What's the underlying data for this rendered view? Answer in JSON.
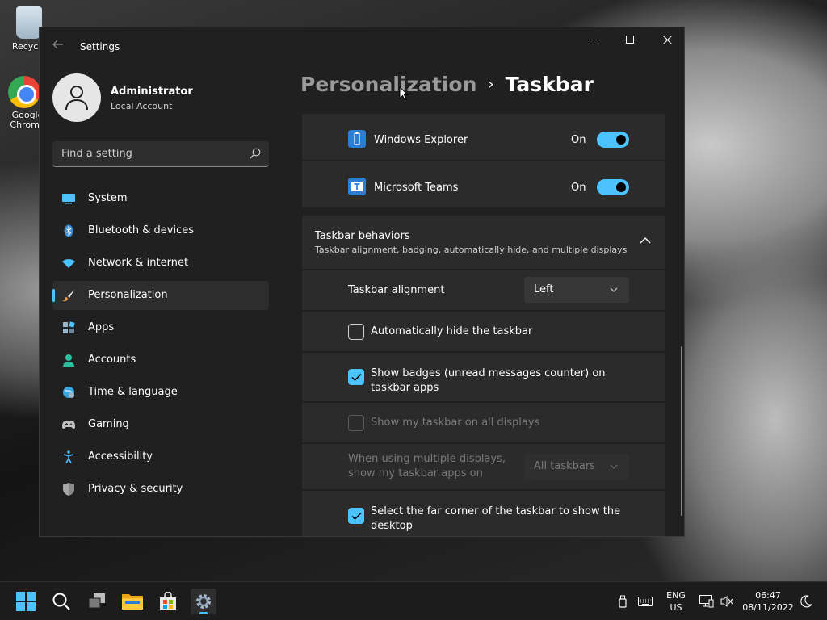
{
  "desktop": {
    "icons": [
      {
        "label": "Recycle"
      },
      {
        "label": "Google Chrome"
      }
    ]
  },
  "window": {
    "title": "Settings",
    "minimize_label": "minimize",
    "maximize_label": "maximize",
    "close_label": "close"
  },
  "profile": {
    "name": "Administrator",
    "account_type": "Local Account"
  },
  "search": {
    "placeholder": "Find a setting"
  },
  "sidebar": {
    "items": [
      {
        "label": "System",
        "icon": "monitor-icon"
      },
      {
        "label": "Bluetooth & devices",
        "icon": "bluetooth-icon"
      },
      {
        "label": "Network & internet",
        "icon": "wifi-icon"
      },
      {
        "label": "Personalization",
        "icon": "brush-icon",
        "active": true
      },
      {
        "label": "Apps",
        "icon": "apps-icon"
      },
      {
        "label": "Accounts",
        "icon": "person-icon"
      },
      {
        "label": "Time & language",
        "icon": "globe-icon"
      },
      {
        "label": "Gaming",
        "icon": "gamepad-icon"
      },
      {
        "label": "Accessibility",
        "icon": "accessibility-icon"
      },
      {
        "label": "Privacy & security",
        "icon": "shield-icon"
      }
    ]
  },
  "breadcrumb": {
    "parent": "Personalization",
    "separator": "›",
    "current": "Taskbar"
  },
  "apps": [
    {
      "label": "Windows Explorer",
      "state": "On"
    },
    {
      "label": "Microsoft Teams",
      "state": "On"
    }
  ],
  "behaviors": {
    "title": "Taskbar behaviors",
    "subtitle": "Taskbar alignment, badging, automatically hide, and multiple displays",
    "alignment_label": "Taskbar alignment",
    "alignment_value": "Left",
    "auto_hide_label": "Automatically hide the taskbar",
    "badges_label": "Show badges (unread messages counter) on taskbar apps",
    "all_displays_label": "Show my taskbar on all displays",
    "multi_display_label": "When using multiple displays, show my taskbar apps on",
    "multi_display_value": "All taskbars",
    "far_corner_label": "Select the far corner of the taskbar to show the desktop"
  },
  "taskbar": {
    "language_line1": "ENG",
    "language_line2": "US",
    "time": "06:47",
    "date": "08/11/2022"
  },
  "colors": {
    "accent": "#4cc2ff",
    "window_bg": "#202020",
    "card_bg": "#2b2b2b"
  }
}
